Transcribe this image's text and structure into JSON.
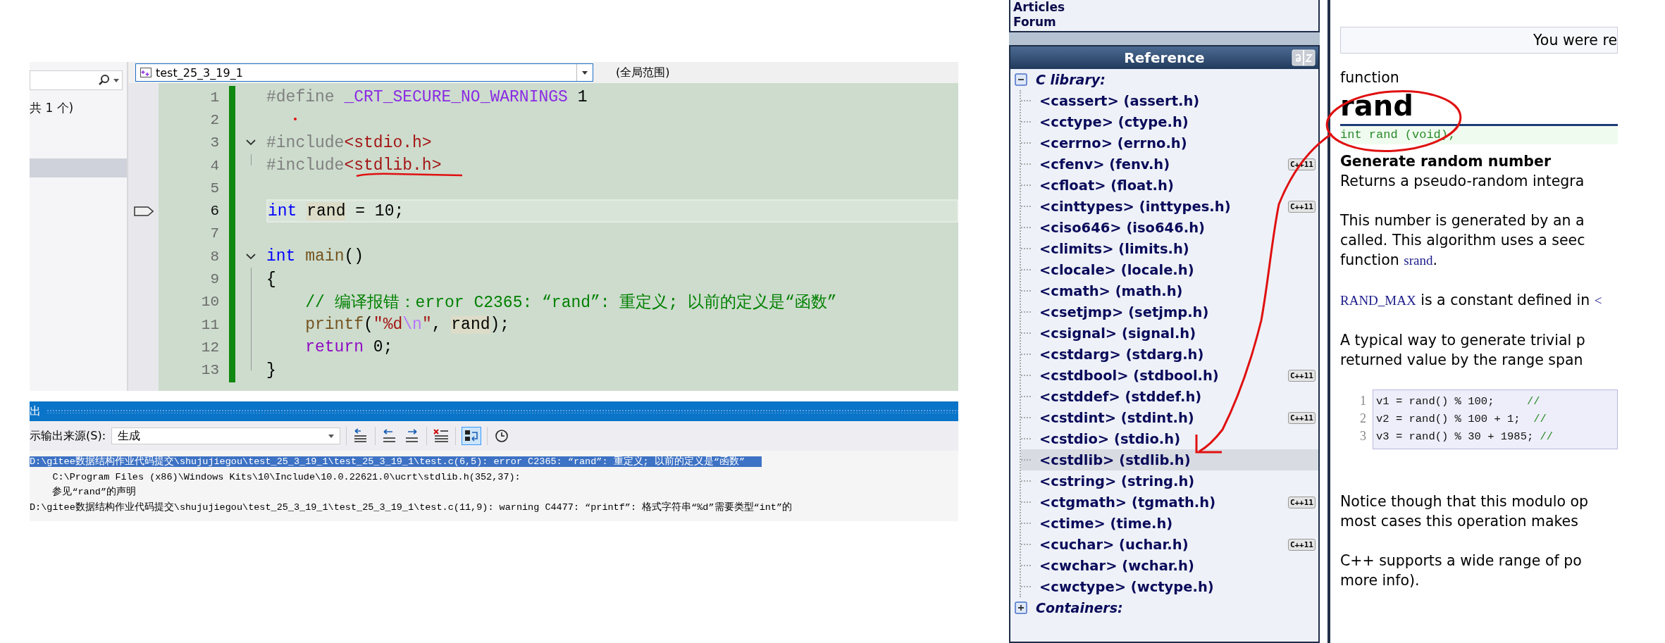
{
  "explorer": {
    "status": "共 1 个)"
  },
  "editor": {
    "file_dropdown": "test_25_3_19_1",
    "scope": "(全局范围)",
    "lines": [
      {
        "number": "1",
        "tokens": [
          {
            "kind": "pre",
            "t": "#define "
          },
          {
            "kind": "macro",
            "t": "_CRT_SECURE_NO_WARNINGS"
          },
          {
            "kind": "plain",
            "t": " 1"
          }
        ]
      },
      {
        "number": "2"
      },
      {
        "number": "3",
        "expanded": true,
        "tokens": [
          {
            "kind": "pre",
            "t": "#include"
          },
          {
            "kind": "str",
            "t": "<stdio.h>"
          }
        ],
        "children": [
          {
            "number": "4",
            "tokens": [
              {
                "kind": "pre",
                "t": "#include"
              },
              {
                "kind": "str",
                "t": "<stdlib.h>"
              }
            ]
          }
        ]
      },
      {
        "number": "5"
      },
      {
        "number": "6",
        "current": true,
        "tokens": [
          {
            "kind": "kw",
            "t": "int "
          },
          {
            "kind": "ref",
            "t": "rand"
          },
          {
            "kind": "plain",
            "t": " = 10;"
          }
        ]
      },
      {
        "number": "7"
      },
      {
        "number": "8",
        "expanded": true,
        "tokens": [
          {
            "kind": "kw",
            "t": "int "
          },
          {
            "kind": "func",
            "t": "main"
          },
          {
            "kind": "plain",
            "t": "()"
          }
        ],
        "children": [
          {
            "number": "9",
            "tokens": [
              {
                "kind": "plain",
                "t": "{"
              }
            ]
          },
          {
            "number": "10",
            "tokens": [
              {
                "kind": "comment",
                "t": "    // 编译报错：error C2365: “rand”: 重定义; 以前的定义是“函数”"
              }
            ]
          },
          {
            "number": "11",
            "tokens": [
              {
                "kind": "func",
                "t": "    printf"
              },
              {
                "kind": "plain",
                "t": "("
              },
              {
                "kind": "str",
                "t": "\"%d"
              },
              {
                "kind": "esc",
                "t": "\\n"
              },
              {
                "kind": "str",
                "t": "\""
              },
              {
                "kind": "plain",
                "t": ", "
              },
              {
                "kind": "ref",
                "t": "rand"
              },
              {
                "kind": "plain",
                "t": ");"
              }
            ]
          },
          {
            "number": "12",
            "tokens": [
              {
                "kind": "ctrl",
                "t": "    return"
              },
              {
                "kind": "plain",
                "t": " 0;"
              }
            ]
          },
          {
            "number": "13",
            "tokens": [
              {
                "kind": "plain",
                "t": "}"
              }
            ]
          }
        ]
      }
    ]
  },
  "output": {
    "title": "出",
    "source_label": "示输出来源(S):",
    "source": "生成",
    "lines": [
      {
        "text": "D:\\gitee数据结构作业代码提交\\shujujiegou\\test_25_3_19_1\\test_25_3_19_1\\test.c(6,5): error C2365: “rand”: 重定义; 以前的定义是“函数”",
        "selected": true
      },
      {
        "text": "    C:\\Program Files (x86)\\Windows Kits\\10\\Include\\10.0.22621.0\\ucrt\\stdlib.h(352,37):",
        "selected": false
      },
      {
        "text": "    参见“rand”的声明",
        "selected": false
      },
      {
        "text": "D:\\gitee数据结构作业代码提交\\shujujiegou\\test_25_3_19_1\\test_25_3_19_1\\test.c(11,9): warning C4477: “printf”: 格式字符串“%d”需要类型“int”的",
        "selected": false
      }
    ]
  },
  "sidebar": {
    "links": [
      "Articles",
      "Forum"
    ],
    "reference_title": "Reference",
    "groups": [
      {
        "label": "C library:",
        "expanded": true,
        "children": [
          {
            "label": "<cassert> (assert.h)",
            "selected": false
          },
          {
            "label": "<cctype> (ctype.h)",
            "selected": false
          },
          {
            "label": "<cerrno> (errno.h)",
            "selected": false
          },
          {
            "label": "<cfenv> (fenv.h)",
            "selected": false,
            "badge": "C++11"
          },
          {
            "label": "<cfloat> (float.h)",
            "selected": false
          },
          {
            "label": "<cinttypes> (inttypes.h)",
            "selected": false,
            "badge": "C++11"
          },
          {
            "label": "<ciso646> (iso646.h)",
            "selected": false
          },
          {
            "label": "<climits> (limits.h)",
            "selected": false
          },
          {
            "label": "<clocale> (locale.h)",
            "selected": false
          },
          {
            "label": "<cmath> (math.h)",
            "selected": false
          },
          {
            "label": "<csetjmp> (setjmp.h)",
            "selected": false
          },
          {
            "label": "<csignal> (signal.h)",
            "selected": false
          },
          {
            "label": "<cstdarg> (stdarg.h)",
            "selected": false
          },
          {
            "label": "<cstdbool> (stdbool.h)",
            "selected": false,
            "badge": "C++11"
          },
          {
            "label": "<cstddef> (stddef.h)",
            "selected": false
          },
          {
            "label": "<cstdint> (stdint.h)",
            "selected": false,
            "badge": "C++11"
          },
          {
            "label": "<cstdio> (stdio.h)",
            "selected": false
          },
          {
            "label": "<cstdlib> (stdlib.h)",
            "selected": true
          },
          {
            "label": "<cstring> (string.h)",
            "selected": false
          },
          {
            "label": "<ctgmath> (tgmath.h)",
            "selected": false,
            "badge": "C++11"
          },
          {
            "label": "<ctime> (time.h)",
            "selected": false
          },
          {
            "label": "<cuchar> (uchar.h)",
            "selected": false,
            "badge": "C++11"
          },
          {
            "label": "<cwchar> (wchar.h)",
            "selected": false
          },
          {
            "label": "<cwctype> (wctype.h)",
            "selected": false
          }
        ]
      },
      {
        "label": "Containers:",
        "expanded": false
      }
    ]
  },
  "article": {
    "notice": "You were re",
    "kind_label": "function",
    "title": "rand",
    "prototype": "int rand (void);",
    "subtitle": "Generate random number",
    "paragraphs": [
      [
        [
          {
            "kind": "text",
            "t": "Returns a pseudo-random integra"
          }
        ]
      ],
      [
        [
          {
            "kind": "text",
            "t": "This number is generated by an a"
          }
        ],
        [
          {
            "kind": "text",
            "t": "called. This algorithm uses a seec"
          }
        ],
        [
          {
            "kind": "text",
            "t": "function "
          },
          {
            "kind": "code",
            "t": "srand"
          },
          {
            "kind": "text",
            "t": "."
          }
        ]
      ],
      [
        [
          {
            "kind": "code",
            "t": "RAND_MAX"
          },
          {
            "kind": "text",
            "t": " is a constant defined in "
          },
          {
            "kind": "code",
            "t": "<"
          }
        ]
      ],
      [
        [
          {
            "kind": "text",
            "t": "A typical way to generate trivial p"
          }
        ],
        [
          {
            "kind": "text",
            "t": "returned value by the range span"
          }
        ]
      ]
    ],
    "example": [
      {
        "number": "1",
        "code": "v1 = rand() % 100;     ",
        "comment": "//"
      },
      {
        "number": "2",
        "code": "v2 = rand() % 100 + 1;  ",
        "comment": "//"
      },
      {
        "number": "3",
        "code": "v3 = rand() % 30 + 1985; ",
        "comment": "//"
      }
    ],
    "paragraphs_after": [
      [
        [
          {
            "kind": "text",
            "t": "Notice though that this modulo op"
          }
        ],
        [
          {
            "kind": "text",
            "t": "most cases this operation makes"
          }
        ]
      ],
      [
        [
          {
            "kind": "text",
            "t": "C++ supports a wide range of po"
          }
        ],
        [
          {
            "kind": "text",
            "t": "more info)."
          }
        ]
      ]
    ]
  }
}
